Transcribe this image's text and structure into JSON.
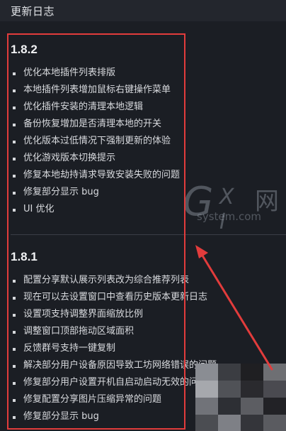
{
  "header": {
    "title": "更新日志"
  },
  "releases": [
    {
      "version": "1.8.2",
      "items": [
        "优化本地插件列表排版",
        "本地插件列表增加鼠标右键操作菜单",
        "优化插件安装的清理本地逻辑",
        "备份恢复增加是否清理本地的开关",
        "优化版本过低情况下强制更新的体验",
        "优化游戏版本切换提示",
        "修复本地劫持请求导致安装失败的问题",
        "修复部分显示 bug",
        "UI 优化"
      ]
    },
    {
      "version": "1.8.1",
      "items": [
        "配置分享默认展示列表改为综合推荐列表",
        "现在可以去设置窗口中查看历史版本更新日志",
        "设置项支持调整界面缩放比例",
        "调整窗口顶部拖动区域面积",
        "反馈群号支持一键复制",
        "解决部分用户设备原因导致工坊网络错误的问题",
        "修复部分用户设置开机自启动启动无效的问题",
        "修复配置分享图片压缩异常的问题",
        "修复部分显示 bug"
      ]
    }
  ],
  "watermark": {
    "logo_g": "G",
    "logo_xi": "X I",
    "logo_cn": "网",
    "site": "system.com"
  },
  "colors": {
    "background": "#1b1e24",
    "text": "#d8dade",
    "annotation": "#e23c3c"
  }
}
